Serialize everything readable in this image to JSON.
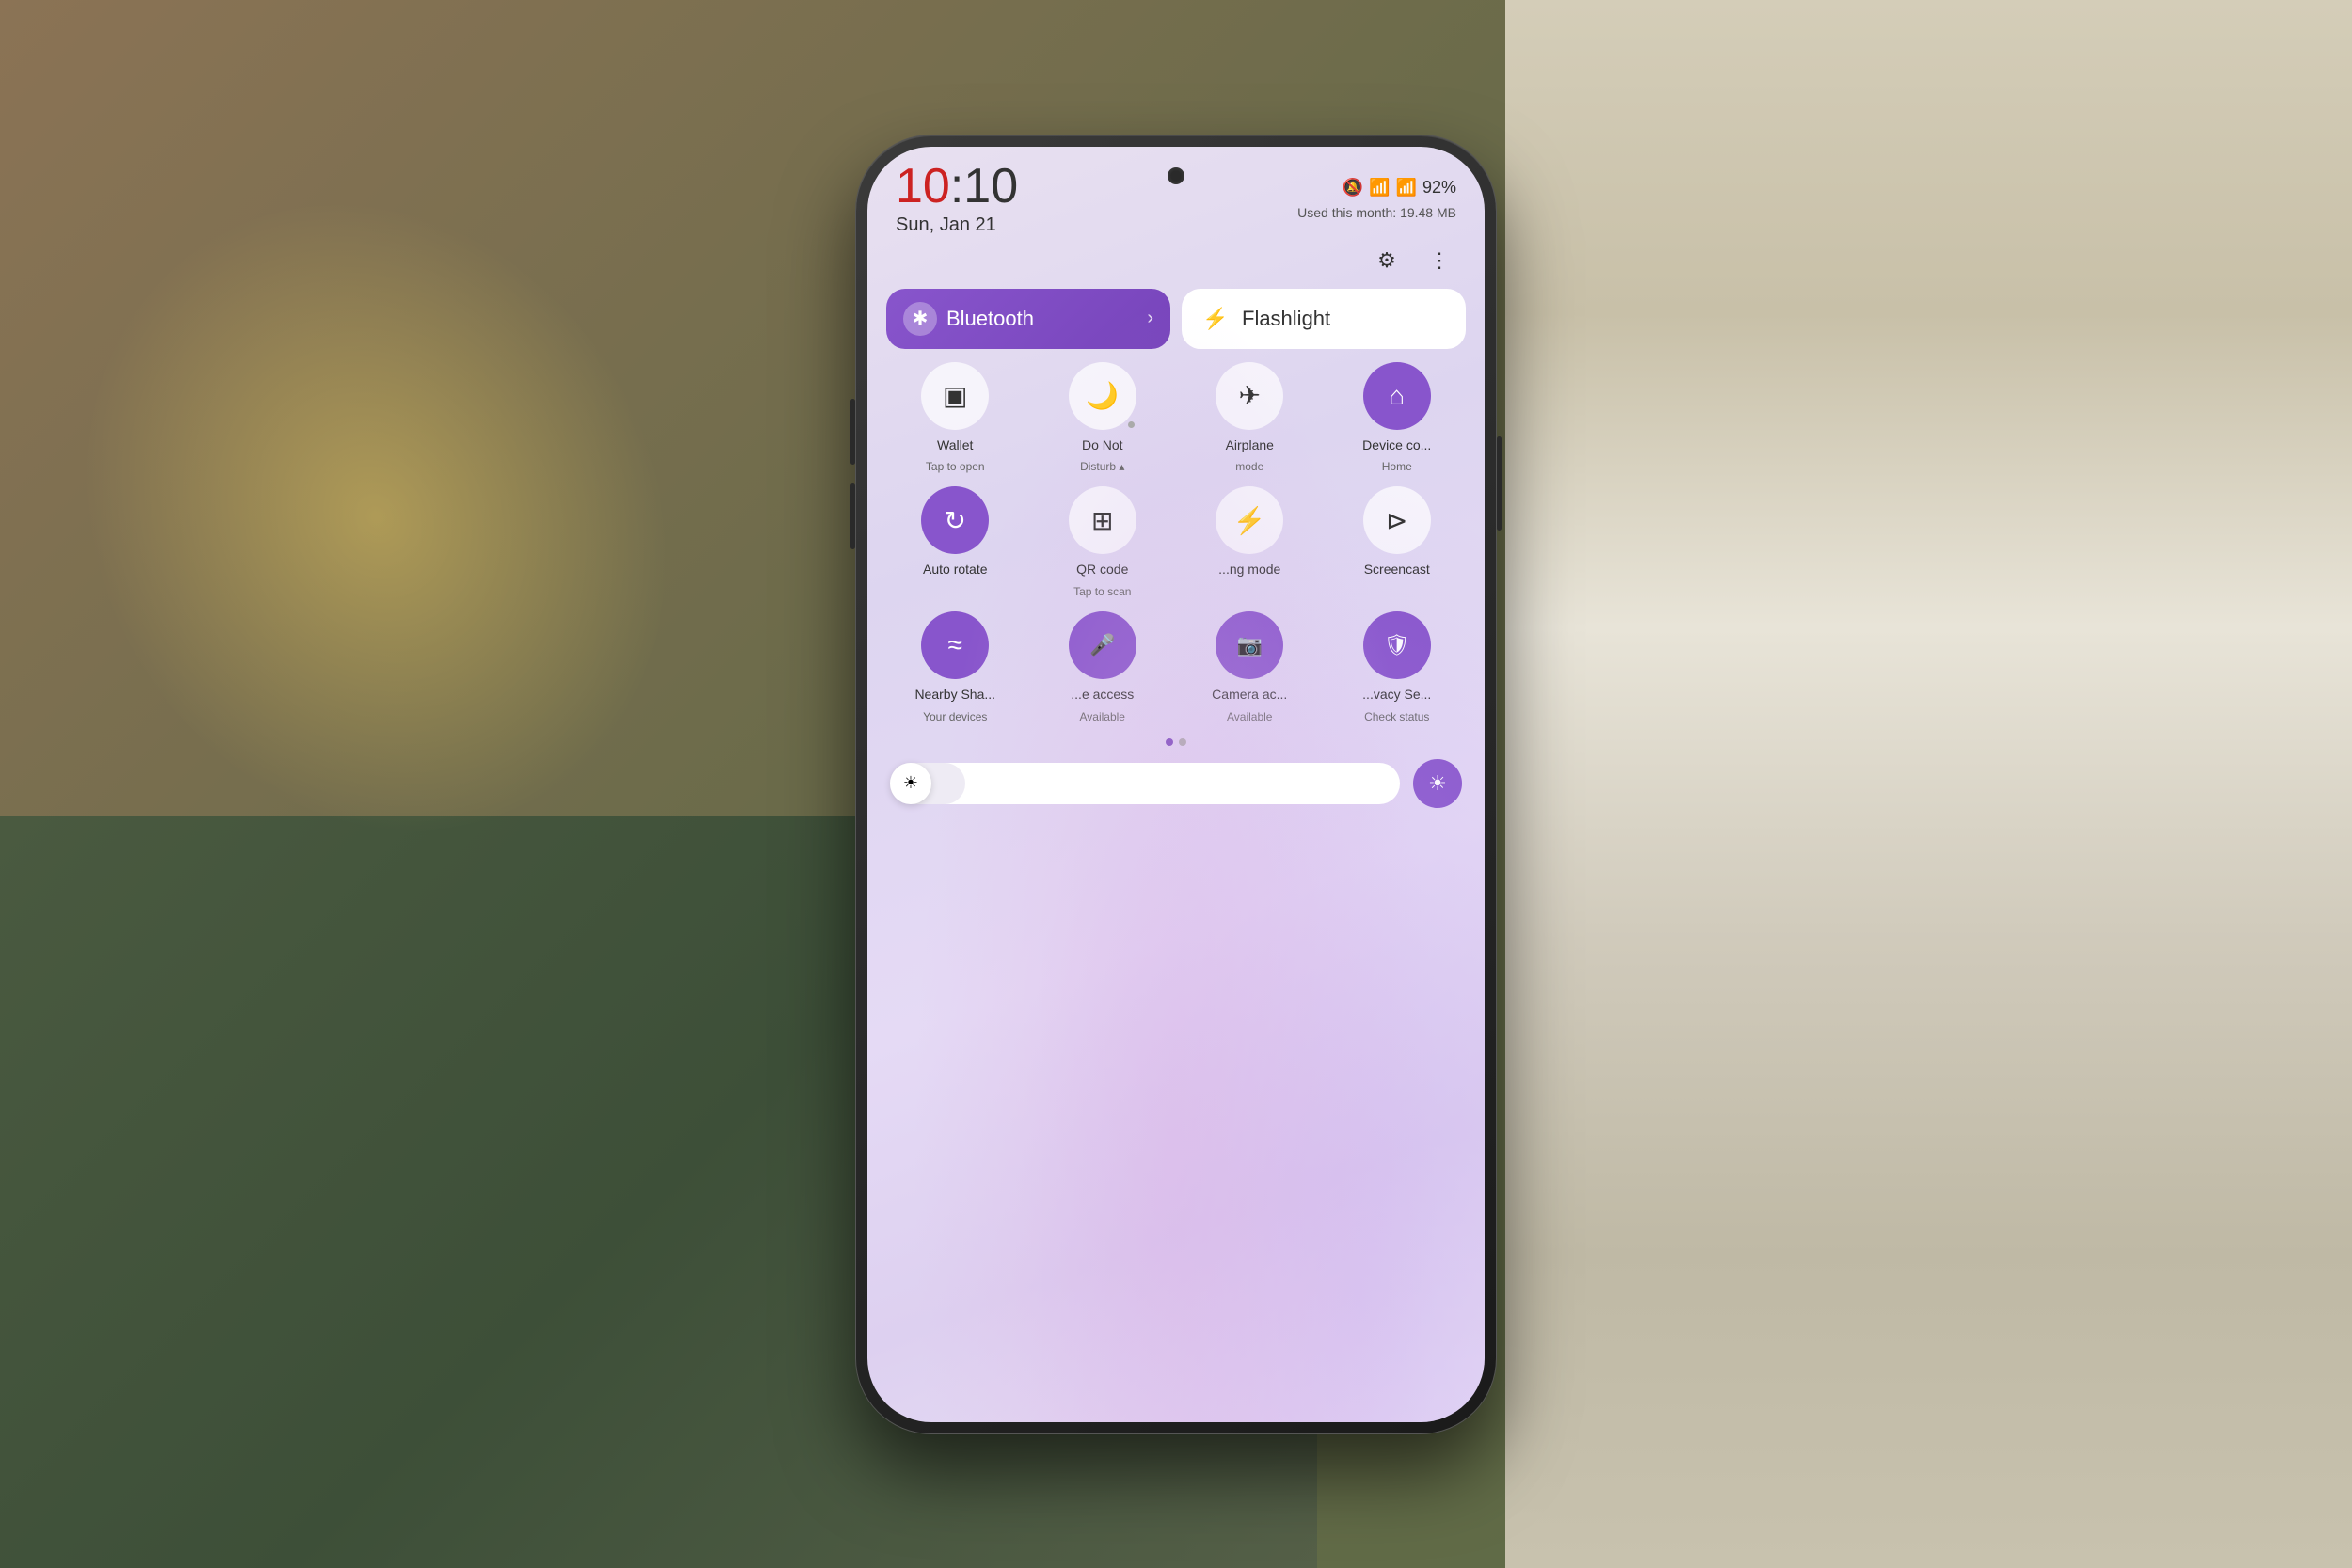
{
  "background": {
    "left_color": "#8b7355",
    "right_color": "#d4cdb8",
    "green_color": "#4a5a40"
  },
  "status_bar": {
    "time": "10:10",
    "hour": "10",
    "colon": ":",
    "minute": "10",
    "date": "Sun, Jan 21",
    "battery": "92%",
    "data_usage": "Used this month: 19.48 MB",
    "icons": {
      "mute": "🔕",
      "wifi": "📶",
      "signal": "📶",
      "battery": "🔋"
    }
  },
  "settings": {
    "settings_icon": "⚙",
    "more_icon": "⋮"
  },
  "bluetooth": {
    "label": "Bluetooth",
    "icon": "✱",
    "active": true,
    "chevron": "›"
  },
  "flashlight": {
    "label": "Flashlight",
    "icon": "⚡",
    "active": false
  },
  "toggles_row1": [
    {
      "id": "wallet",
      "label": "Wallet",
      "sublabel": "Tap to open",
      "icon": "▣",
      "active": false
    },
    {
      "id": "dnd",
      "label": "Do Not",
      "sublabel": "Disturb",
      "icon": "🌙",
      "active": false,
      "has_dot": true
    },
    {
      "id": "airplane",
      "label": "Airplane",
      "sublabel": "mode",
      "icon": "✈",
      "active": false
    },
    {
      "id": "device-controls",
      "label": "Device co...",
      "sublabel": "Home",
      "icon": "⌂",
      "active": true
    }
  ],
  "toggles_row2": [
    {
      "id": "auto-rotate",
      "label": "Auto rotate",
      "sublabel": "",
      "icon": "↻",
      "active": true
    },
    {
      "id": "qr-code",
      "label": "QR code",
      "sublabel": "Tap to scan",
      "icon": "⊞",
      "active": false
    },
    {
      "id": "charging-mode",
      "label": "...ng mode",
      "sublabel": "",
      "icon": "⚡",
      "active": false
    },
    {
      "id": "screencast",
      "label": "Screencast",
      "sublabel": "",
      "icon": "⊳",
      "active": false
    }
  ],
  "toggles_row3": [
    {
      "id": "nearby-share",
      "label": "Nearby Sha...",
      "sublabel": "Your devices",
      "icon": "≈",
      "active": true
    },
    {
      "id": "mic-access",
      "label": "...e access",
      "sublabel": "Available",
      "icon": "♪",
      "active": true
    },
    {
      "id": "camera-access",
      "label": "Camera ac...",
      "sublabel": "Available",
      "icon": "◉",
      "active": true
    },
    {
      "id": "privacy",
      "label": "...vacy Se...",
      "sublabel": "Check status",
      "icon": "◈",
      "active": true
    }
  ],
  "pagination": {
    "dots": [
      {
        "active": true
      },
      {
        "active": false
      }
    ]
  },
  "brightness": {
    "icon": "☀",
    "auto_icon": "☀",
    "level": 20
  }
}
